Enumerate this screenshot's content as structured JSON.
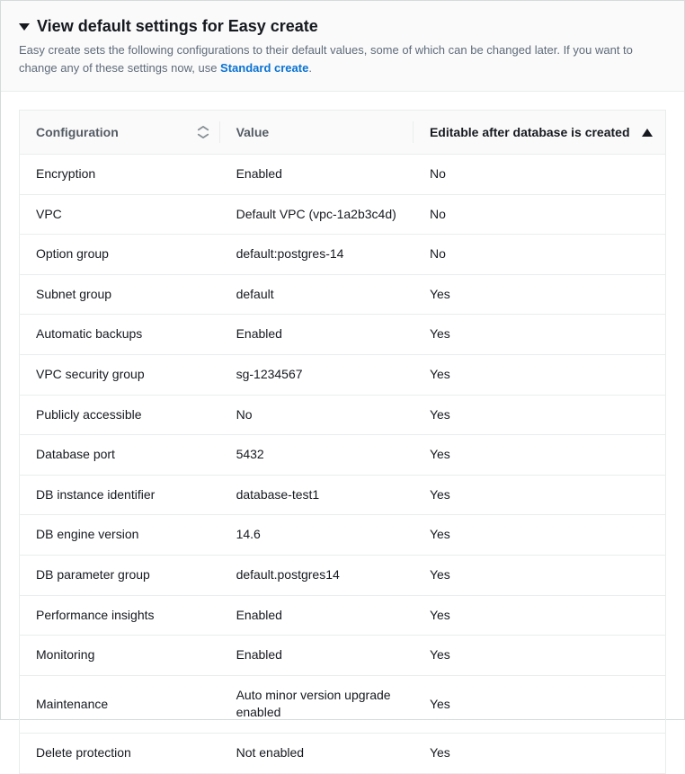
{
  "header": {
    "title": "View default settings for Easy create",
    "description_pre": "Easy create sets the following configurations to their default values, some of which can be changed later. If you want to change any of these settings now, use ",
    "description_link": "Standard create",
    "description_post": "."
  },
  "table": {
    "columns": {
      "config": "Configuration",
      "value": "Value",
      "editable": "Editable after database is created"
    },
    "rows": [
      {
        "config": "Encryption",
        "value": "Enabled",
        "editable": "No"
      },
      {
        "config": "VPC",
        "value": "Default VPC (vpc-1a2b3c4d)",
        "editable": "No"
      },
      {
        "config": "Option group",
        "value": "default:postgres-14",
        "editable": "No"
      },
      {
        "config": "Subnet group",
        "value": "default",
        "editable": "Yes"
      },
      {
        "config": "Automatic backups",
        "value": "Enabled",
        "editable": "Yes"
      },
      {
        "config": "VPC security group",
        "value": "sg-1234567",
        "editable": "Yes"
      },
      {
        "config": "Publicly accessible",
        "value": "No",
        "editable": "Yes"
      },
      {
        "config": "Database port",
        "value": "5432",
        "editable": "Yes"
      },
      {
        "config": "DB instance identifier",
        "value": "database-test1",
        "editable": "Yes"
      },
      {
        "config": "DB engine version",
        "value": "14.6",
        "editable": "Yes"
      },
      {
        "config": "DB parameter group",
        "value": "default.postgres14",
        "editable": "Yes"
      },
      {
        "config": "Performance insights",
        "value": "Enabled",
        "editable": "Yes"
      },
      {
        "config": "Monitoring",
        "value": "Enabled",
        "editable": "Yes"
      },
      {
        "config": "Maintenance",
        "value": "Auto minor version upgrade enabled",
        "editable": "Yes"
      },
      {
        "config": "Delete protection",
        "value": "Not enabled",
        "editable": "Yes"
      }
    ]
  }
}
